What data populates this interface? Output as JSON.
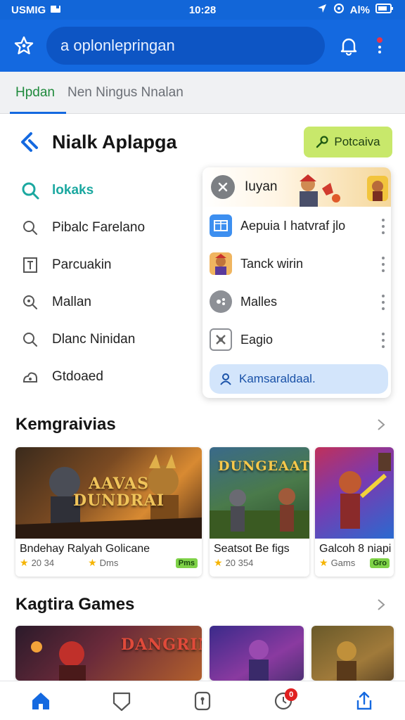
{
  "status_bar": {
    "carrier": "USMIG",
    "time": "10:28",
    "battery": "Al%"
  },
  "app_bar": {
    "search_text": "a oplonlepringan"
  },
  "tabs": [
    {
      "label": "Hpdan",
      "active": true
    },
    {
      "label": "Nen Ningus Nnalan",
      "active": false
    }
  ],
  "header": {
    "title": "Nialk Aplapga",
    "download_label": "Potcaiva"
  },
  "side_menu": [
    {
      "label": "lokaks",
      "icon": "search-icon",
      "active": true
    },
    {
      "label": "Pibalc Farelano",
      "icon": "search-outline-icon"
    },
    {
      "label": "Parcuakin",
      "icon": "document-icon"
    },
    {
      "label": "Mallan",
      "icon": "zoom-icon"
    },
    {
      "label": "Dlanc Ninidan",
      "icon": "search-icon"
    },
    {
      "label": "Gtdoaed",
      "icon": "cloud-user-icon"
    }
  ],
  "popup": {
    "title": "Iuyan",
    "items": [
      {
        "label": "Aepuia I hatvraf jlo",
        "icon": "window-icon"
      },
      {
        "label": "Tanck wirin",
        "icon": "avatar-thumb-icon"
      },
      {
        "label": "Malles",
        "icon": "gamepad-icon"
      },
      {
        "label": "Eagio",
        "icon": "puzzle-icon"
      }
    ],
    "action_label": "Kamsaraldaal."
  },
  "section1": {
    "title": "Kemgraivias",
    "cards": [
      {
        "name": "Bndehay Ralyah Golicane",
        "rating": "20 34",
        "installs": "Dms",
        "badge": "Pms",
        "art_title": "AAVAS\nDUNDRAI"
      },
      {
        "name": "Seatsot Be figs",
        "rating": "20 354",
        "art_title": "DUNGEAAT"
      },
      {
        "name": "Galcoh 8 niapi",
        "rating": "Gams",
        "badge": "Gro"
      }
    ]
  },
  "section2": {
    "title": "Kagtira Games",
    "cards": [
      {
        "art_title": "DANGRIM"
      },
      {},
      {}
    ]
  },
  "bottom_nav": {
    "notification_count": "0"
  },
  "colors": {
    "primary": "#1469e0",
    "accent_green": "#1f8a3c",
    "download_bg": "#c8e86b",
    "active_teal": "#1ba8a0"
  }
}
